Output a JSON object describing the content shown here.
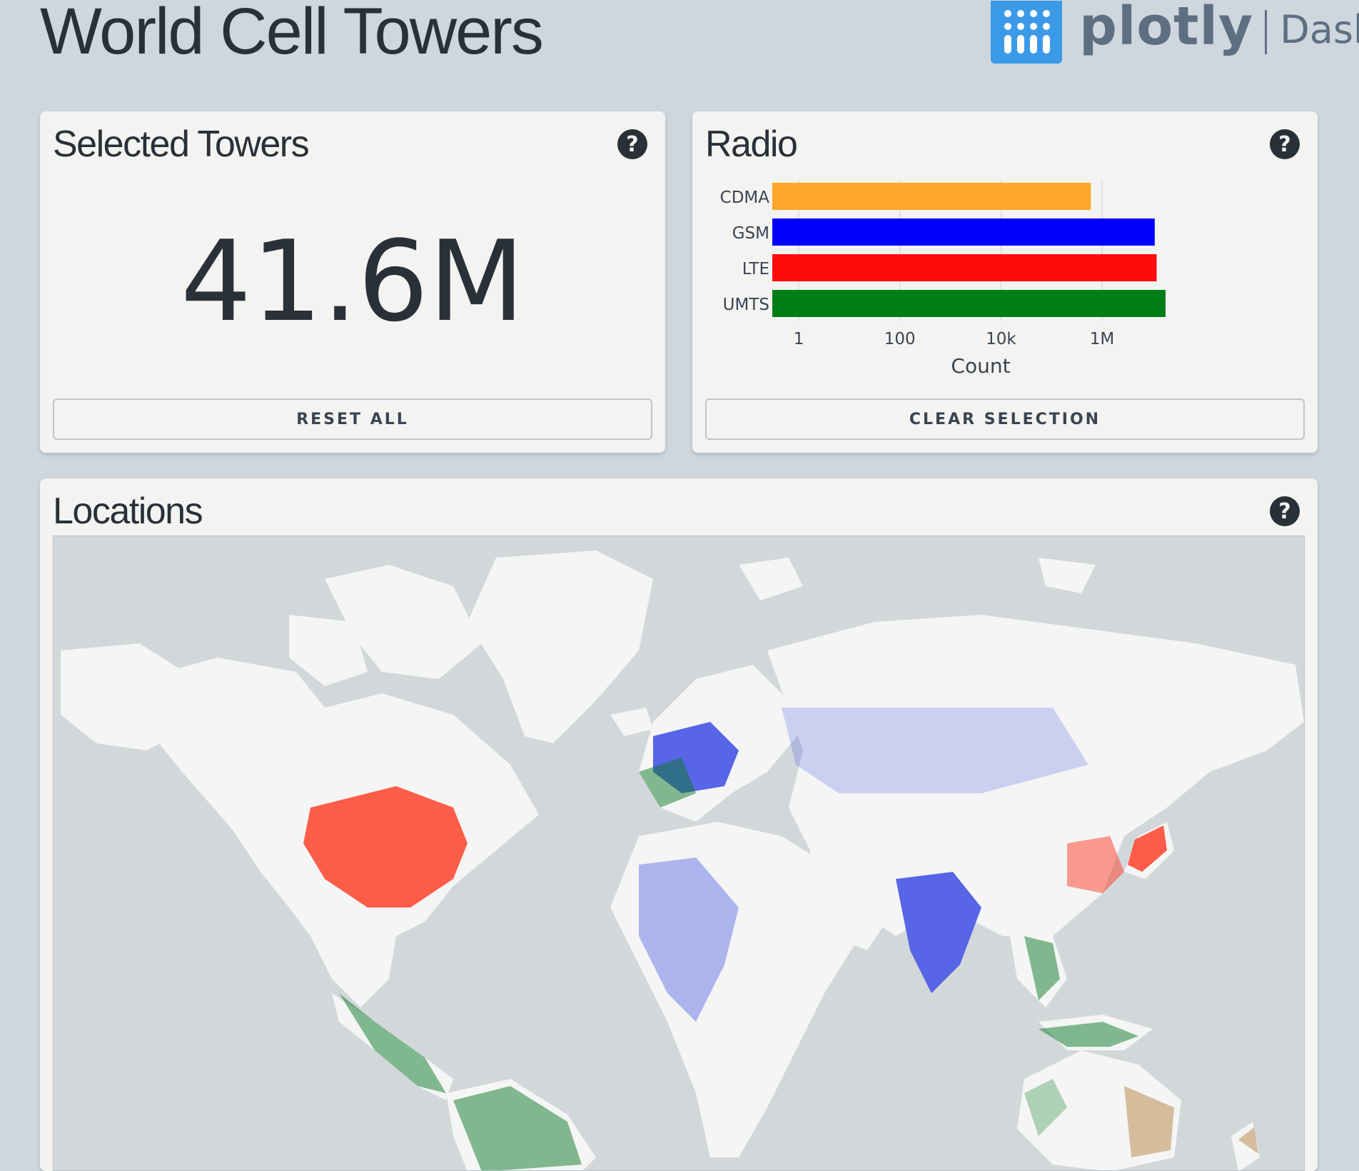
{
  "header": {
    "title": "World Cell Towers",
    "brand_word": "plotly",
    "brand_product": "Dash"
  },
  "selected_towers": {
    "title": "Selected Towers",
    "value": "41.6M",
    "reset_label": "RESET ALL"
  },
  "radio": {
    "title": "Radio",
    "clear_label": "CLEAR SELECTION"
  },
  "locations": {
    "title": "Locations"
  },
  "colors": {
    "CDMA": "#ffa62b",
    "GSM": "#0000ff",
    "LTE": "#ff0b0b",
    "UMTS": "#007e16",
    "background": "#cfd7de",
    "card": "#f3f3f1",
    "map_water": "#d2d8da",
    "map_land": "#f4f5f4"
  },
  "chart_data": {
    "type": "bar",
    "orientation": "horizontal",
    "categories": [
      "CDMA",
      "GSM",
      "LTE",
      "UMTS"
    ],
    "values": [
      600000,
      11000000,
      12000000,
      18000000
    ],
    "xscale": "log",
    "xlim": [
      0.3,
      60000000
    ],
    "xticks": [
      1,
      100,
      10000,
      1000000
    ],
    "xtick_labels": [
      "1",
      "100",
      "10k",
      "1M"
    ],
    "xlabel": "Count",
    "grid": true
  }
}
